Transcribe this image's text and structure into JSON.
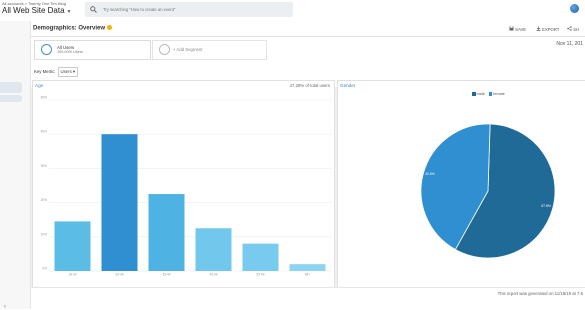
{
  "topbar": {
    "breadcrumb": "All accounts > Twenty One Ten Blog",
    "property": "All Web Site Data",
    "search_placeholder": "Try searching \"How to create an event\""
  },
  "report": {
    "title": "Demographics: Overview",
    "actions": {
      "save": "SAVE",
      "export": "EXPORT",
      "share": "SH"
    }
  },
  "segments": {
    "all_users": "All Users",
    "all_users_pct": "100.00% Users",
    "add_segment": "+ Add Segment"
  },
  "date_range": "Nov 11, 201",
  "key_metric": {
    "label": "Key Metric:",
    "value": "Users"
  },
  "age_card": {
    "title": "Age",
    "pct_label": "47.28% of total users"
  },
  "gender_card": {
    "title": "Gender"
  },
  "footer": "This report was generated on 11/18/19 at 7:5",
  "colors": {
    "male": "#1f6a96",
    "female": "#2f8fd0",
    "age_bars": [
      "#5bbde6",
      "#2f8fd0",
      "#4eb3e3",
      "#72c8ec",
      "#78caee",
      "#8fd3f2"
    ]
  },
  "chart_data": [
    {
      "type": "bar",
      "title": "Age",
      "categories": [
        "18-24",
        "25-34",
        "35-44",
        "45-54",
        "55-64",
        "65+"
      ],
      "values": [
        14.5,
        40.0,
        22.5,
        12.5,
        8.0,
        2.0
      ],
      "ylim": [
        0,
        50
      ],
      "yticks": [
        "0%",
        "10%",
        "20%",
        "30%",
        "40%",
        "50%"
      ],
      "grid": true
    },
    {
      "type": "pie",
      "title": "Gender",
      "categories": [
        "male",
        "female"
      ],
      "values": [
        57.6,
        42.4
      ],
      "labels": [
        "57.6%",
        "42.4%"
      ],
      "legend": "top"
    }
  ]
}
